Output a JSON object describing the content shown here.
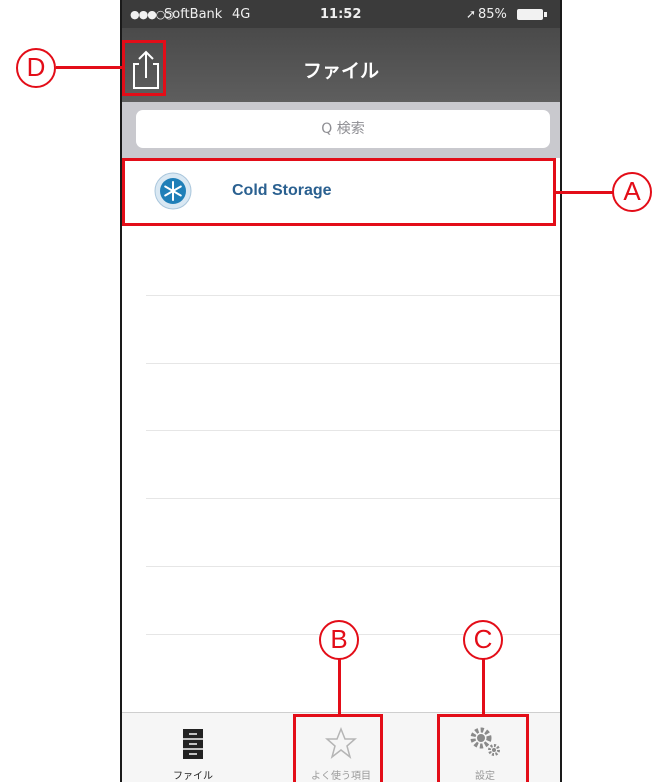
{
  "status_bar": {
    "signal": "●●●○○",
    "carrier": "SoftBank",
    "network": "4G",
    "time": "11:52",
    "location_glyph": "➚",
    "battery": "85%"
  },
  "nav": {
    "title": "ファイル",
    "share_icon": "share-icon"
  },
  "search": {
    "placeholder": "Q 検索"
  },
  "files": [
    {
      "name": "Cold Storage",
      "icon": "snowflake-icon"
    }
  ],
  "tabs": [
    {
      "label": "ファイル",
      "icon": "file-cabinet-icon",
      "selected": true
    },
    {
      "label": "よく使う項目",
      "icon": "star-icon",
      "selected": false
    },
    {
      "label": "設定",
      "icon": "gears-icon",
      "selected": false
    }
  ],
  "annotations": {
    "a": "A",
    "b": "B",
    "c": "C",
    "d": "D"
  },
  "colors": {
    "annotation_red": "#e30d18",
    "nav_bar": "#555555",
    "link_blue": "#2a6090"
  }
}
